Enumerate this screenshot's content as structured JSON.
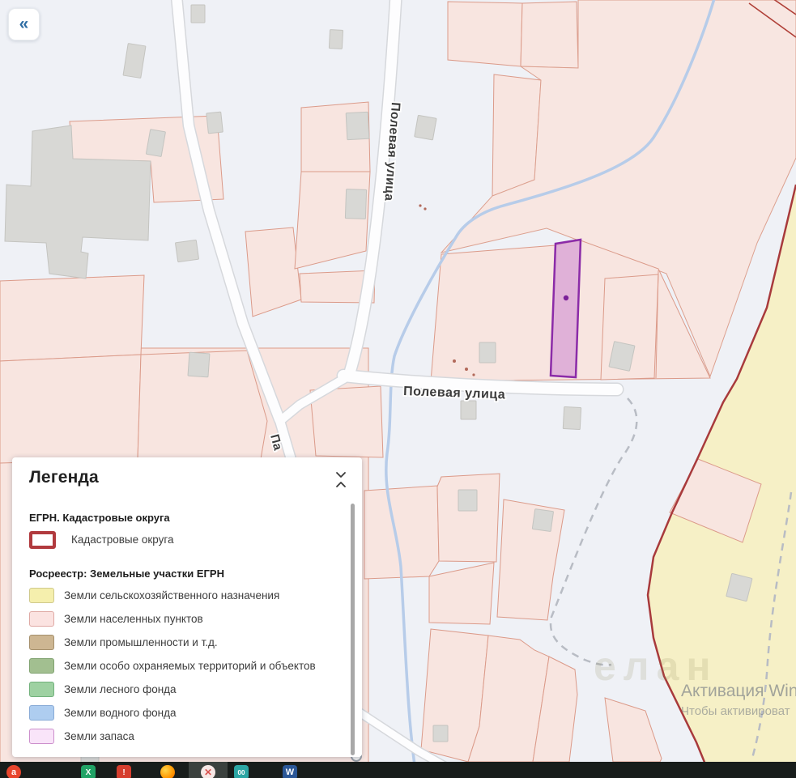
{
  "sidebar_toggle": {
    "icon": "«"
  },
  "map": {
    "street_label_vertical": "Полевая улица",
    "street_label_horizontal": "Полевая улица",
    "street_label_partial": "Па",
    "map_watermark": "елан",
    "selected_parcel_border": "#8b2ba8",
    "cadastral_boundary_color": "#a83a3c",
    "water_color": "#b7cce9"
  },
  "legend": {
    "title": "Легенда",
    "collapse_icon": "collapse-vertical",
    "sections": [
      {
        "header": "ЕГРН. Кадастровые округа",
        "items": [
          {
            "label": "Кадастровые округа",
            "fill": "#ffffff",
            "border": "#b13a3e",
            "thick": true
          }
        ]
      },
      {
        "header": "Росреестр: Земельные участки ЕГРН",
        "items": [
          {
            "label": "Земли сельскохозяйственного назначения",
            "fill": "#f5efad",
            "border": "#cfc98b"
          },
          {
            "label": "Земли населенных пунктов",
            "fill": "#fbe3e1",
            "border": "#dfa9a4"
          },
          {
            "label": "Земли промышленности и т.д.",
            "fill": "#cdb692",
            "border": "#a5906c"
          },
          {
            "label": "Земли особо охраняемых территорий и объектов",
            "fill": "#a2bf90",
            "border": "#81a371"
          },
          {
            "label": "Земли лесного фонда",
            "fill": "#9ed1a2",
            "border": "#72b27c"
          },
          {
            "label": "Земли водного фонда",
            "fill": "#aecdf0",
            "border": "#89abd6"
          },
          {
            "label": "Земли запаса",
            "fill": "#f9e4f9",
            "border": "#cc8fcc"
          }
        ]
      }
    ]
  },
  "windows_watermark": {
    "line1": "Активация Win",
    "line2": "Чтобы активироват"
  },
  "taskbar": {
    "icons": [
      {
        "name": "red-browser-icon",
        "glyph": "a"
      },
      {
        "name": "excel-icon",
        "glyph": "X"
      },
      {
        "name": "red-app-icon",
        "glyph": "!"
      },
      {
        "name": "firefox-icon",
        "glyph": ""
      },
      {
        "name": "map-app-icon",
        "glyph": "✕"
      },
      {
        "name": "teal-app-icon",
        "glyph": "00"
      },
      {
        "name": "word-icon",
        "glyph": "W"
      }
    ]
  }
}
